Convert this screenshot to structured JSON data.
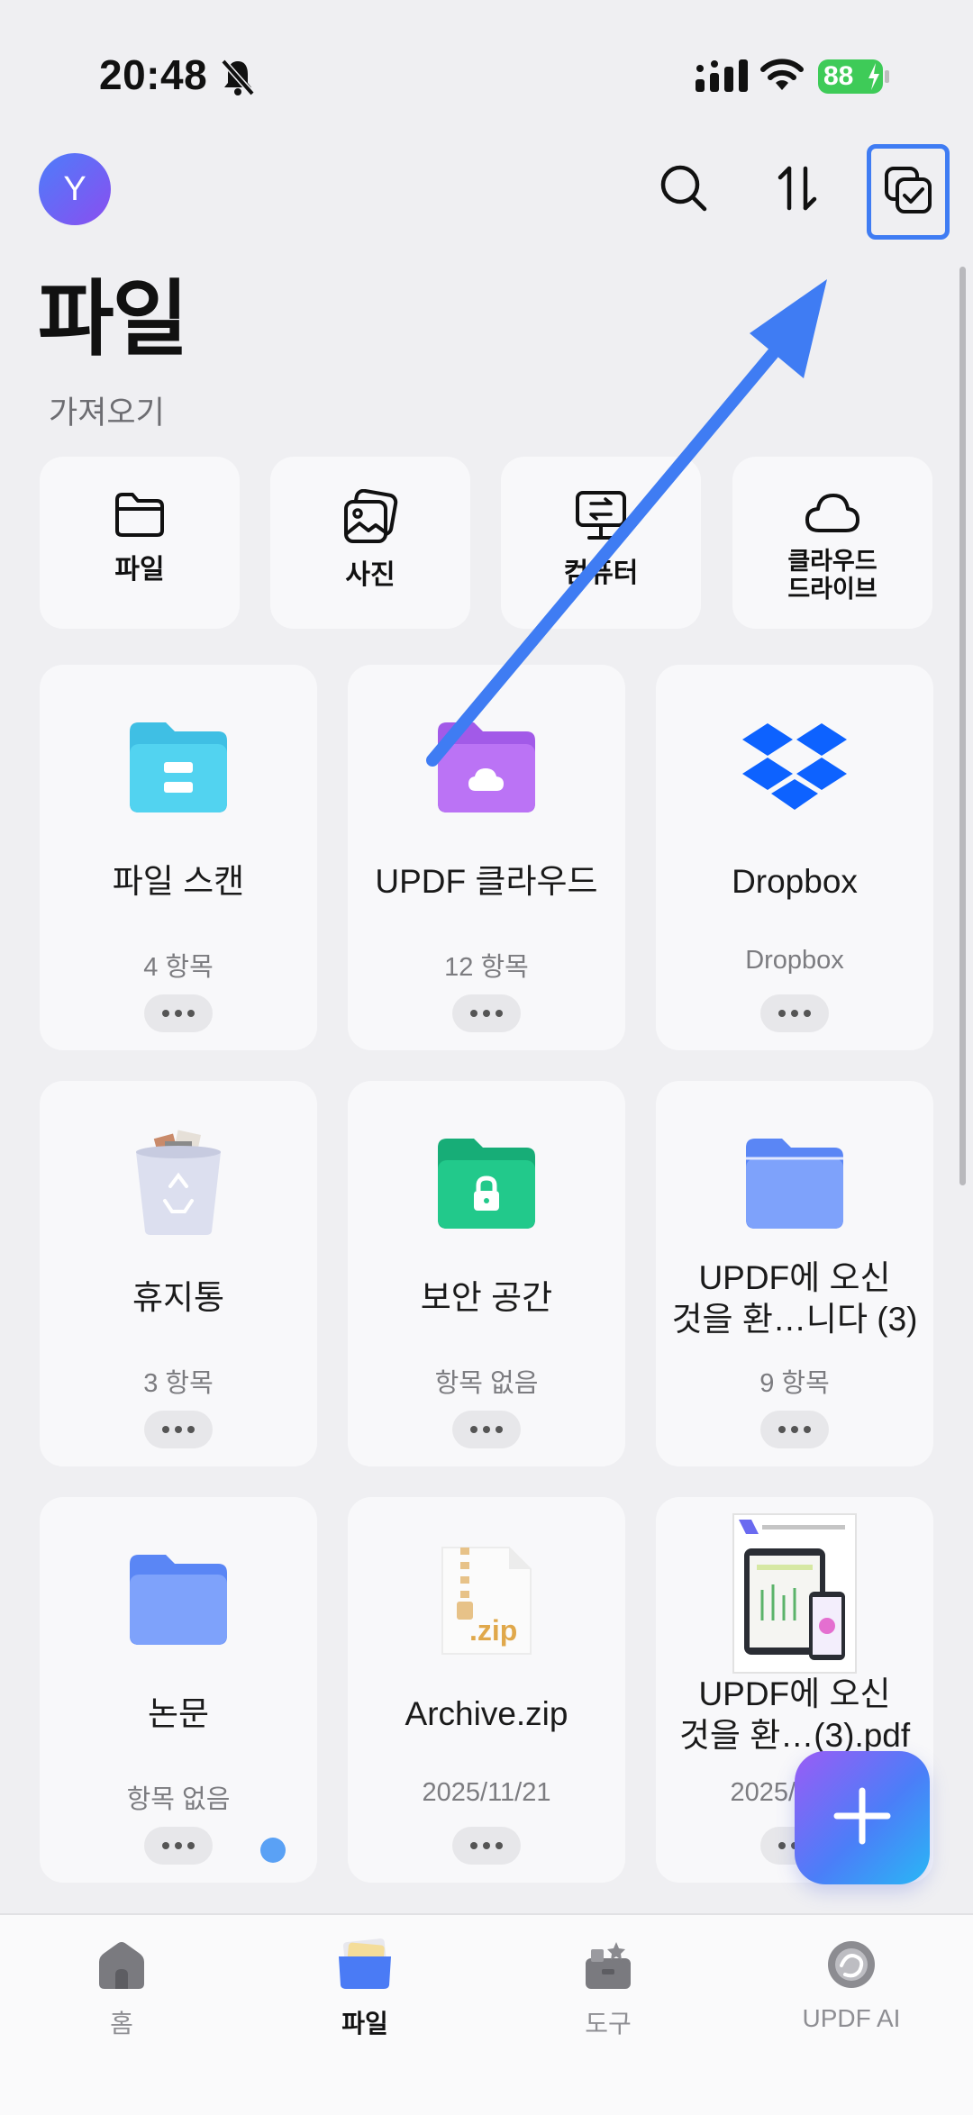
{
  "status_bar": {
    "time": "20:48",
    "battery": "88"
  },
  "header": {
    "avatar_letter": "Y",
    "title": "파일",
    "import_section_label": "가져오기"
  },
  "import_buttons": [
    {
      "label": "파일",
      "icon": "folder-outline-icon"
    },
    {
      "label": "사진",
      "icon": "photo-icon"
    },
    {
      "label": "컴퓨터",
      "icon": "computer-transfer-icon"
    },
    {
      "label": "클라우드\n드라이브",
      "icon": "cloud-icon"
    }
  ],
  "cards": [
    {
      "title": "파일 스캔",
      "sub": "4 항목",
      "icon": "scan-folder-icon"
    },
    {
      "title": "UPDF 클라우드",
      "sub": "12 항목",
      "icon": "cloud-folder-icon"
    },
    {
      "title": "Dropbox",
      "sub": "Dropbox",
      "icon": "dropbox-icon"
    },
    {
      "title": "휴지통",
      "sub": "3 항목",
      "icon": "trash-icon"
    },
    {
      "title": "보안 공간",
      "sub": "항목 없음",
      "icon": "lock-folder-icon"
    },
    {
      "title": "UPDF에 오신\n것을 환…니다 (3)",
      "sub": "9 항목",
      "icon": "folder-icon"
    },
    {
      "title": "논문",
      "sub": "항목 없음",
      "icon": "folder-icon"
    },
    {
      "title": "Archive.zip",
      "sub": "2025/11/21",
      "icon": "zip-file-icon"
    },
    {
      "title": "UPDF에 오신\n것을 환…(3).pdf",
      "sub": "2025/11/21",
      "icon": "pdf-thumbnail-icon",
      "zip_label": ".zip"
    }
  ],
  "tabs": [
    {
      "label": "홈",
      "icon": "home-icon"
    },
    {
      "label": "파일",
      "icon": "files-icon",
      "active": true
    },
    {
      "label": "도구",
      "icon": "tools-icon"
    },
    {
      "label": "UPDF AI",
      "icon": "ai-icon"
    }
  ],
  "colors": {
    "accent": "#3f7cf3",
    "scan_folder": "#3fc3e6",
    "cloud_folder": "#b269f3",
    "lock_folder": "#23c48a",
    "plain_folder": "#6f98fb",
    "dropbox": "#0d62ff"
  },
  "zip_label": ".zip"
}
